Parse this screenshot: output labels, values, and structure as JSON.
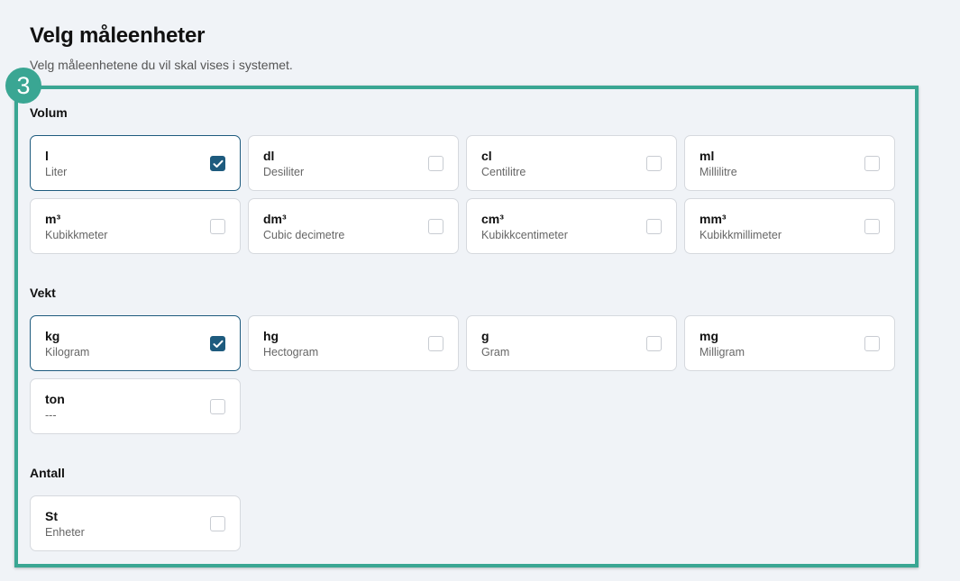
{
  "header": {
    "title": "Velg måleenheter",
    "subtitle": "Velg måleenhetene du vil skal vises i systemet."
  },
  "step_badge": "3",
  "sections": [
    {
      "label": "Volum",
      "units": [
        {
          "symbol": "l",
          "name": "Liter",
          "checked": true
        },
        {
          "symbol": "dl",
          "name": "Desiliter",
          "checked": false
        },
        {
          "symbol": "cl",
          "name": "Centilitre",
          "checked": false
        },
        {
          "symbol": "ml",
          "name": "Millilitre",
          "checked": false
        },
        {
          "symbol": "m³",
          "name": "Kubikkmeter",
          "checked": false
        },
        {
          "symbol": "dm³",
          "name": "Cubic decimetre",
          "checked": false
        },
        {
          "symbol": "cm³",
          "name": "Kubikkcentimeter",
          "checked": false
        },
        {
          "symbol": "mm³",
          "name": "Kubikkmillimeter",
          "checked": false
        }
      ]
    },
    {
      "label": "Vekt",
      "units": [
        {
          "symbol": "kg",
          "name": "Kilogram",
          "checked": true
        },
        {
          "symbol": "hg",
          "name": "Hectogram",
          "checked": false
        },
        {
          "symbol": "g",
          "name": "Gram",
          "checked": false
        },
        {
          "symbol": "mg",
          "name": "Milligram",
          "checked": false
        },
        {
          "symbol": "ton",
          "name": "---",
          "checked": false
        }
      ]
    },
    {
      "label": "Antall",
      "units": [
        {
          "symbol": "St",
          "name": "Enheter",
          "checked": false
        }
      ]
    }
  ],
  "colors": {
    "accent": "#3aa693",
    "checkbox_checked": "#1e5b7e",
    "background": "#f0f3f7"
  }
}
